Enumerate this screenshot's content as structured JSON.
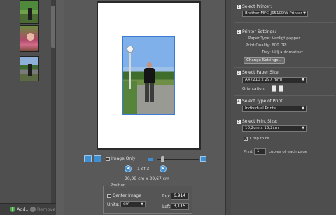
{
  "left_panel": {
    "add_label": "Add...",
    "remove_label": "Remove"
  },
  "preview": {
    "image_only_label": "Image Only",
    "page_count": "1 of 3",
    "page_size": "20,99 cm x 29,67 cm",
    "position": {
      "legend": "Position",
      "center_image_label": "Center Image",
      "units_label": "Units:",
      "units_value": "cm",
      "top_label": "Top:",
      "top_value": "6,914",
      "left_label": "Left:",
      "left_value": "3,115"
    }
  },
  "panel": {
    "step1": {
      "num": "1",
      "label": "Select Printer:",
      "value": "Brother MFC-J6510DW Printer"
    },
    "step2": {
      "num": "2",
      "label": "Printer Settings:",
      "paper_type": "Paper Type: Vanligt papper",
      "print_quality": "Print Quality: 600 DPI",
      "tray": "Tray: Välj automatiskt",
      "change_button": "Change Settings..."
    },
    "step3": {
      "num": "3",
      "label": "Select Paper Size:",
      "value": "A4 (210 x 297 mm)",
      "orientation_label": "Orientation:"
    },
    "step4": {
      "num": "4",
      "label": "Select Type of Print:",
      "value": "Individual Prints"
    },
    "step5": {
      "num": "5",
      "label": "Select Print Size:",
      "value": "10,2cm x 15,2cm",
      "crop_label": "Crop to Fit"
    },
    "print_label": "Print",
    "copies_value": "1",
    "copies_label": "copies of each page"
  }
}
